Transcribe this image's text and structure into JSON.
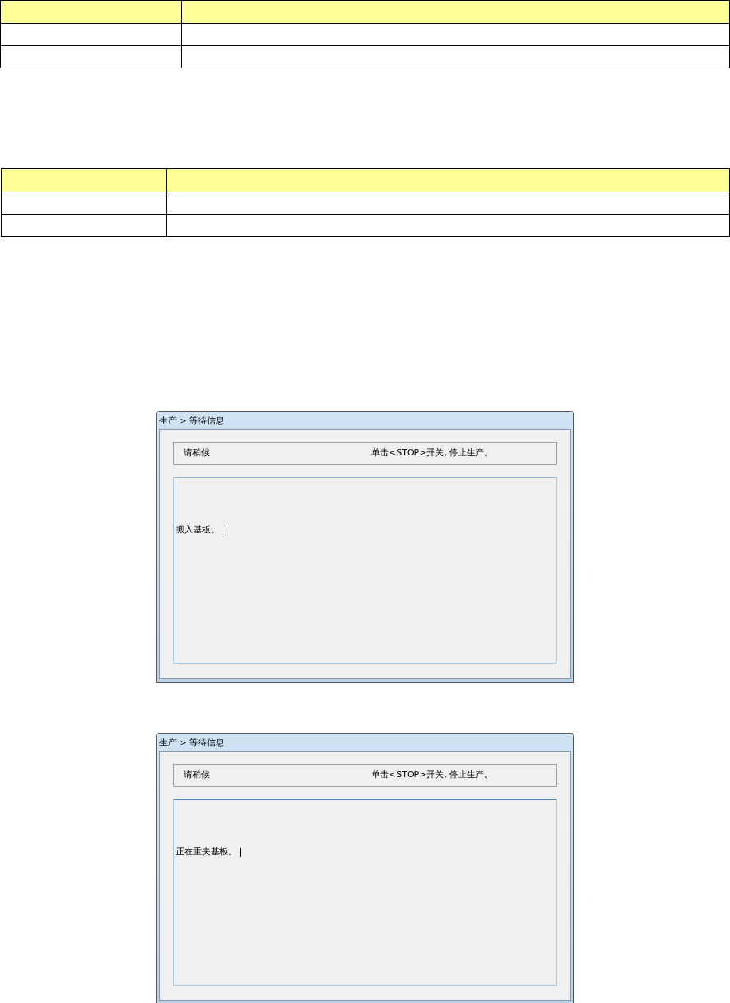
{
  "dialogs": [
    {
      "title": "生产 > 等待信息",
      "status": "请稍候",
      "instruction": "单击<STOP>开关, 停止生产。",
      "message": "搬入基板。",
      "cursor": true
    },
    {
      "title": "生产 > 等待信息",
      "status": "请稍候",
      "instruction": "单击<STOP>开关, 停止生产。",
      "message": "正在重夹基板。",
      "cursor": true
    }
  ]
}
